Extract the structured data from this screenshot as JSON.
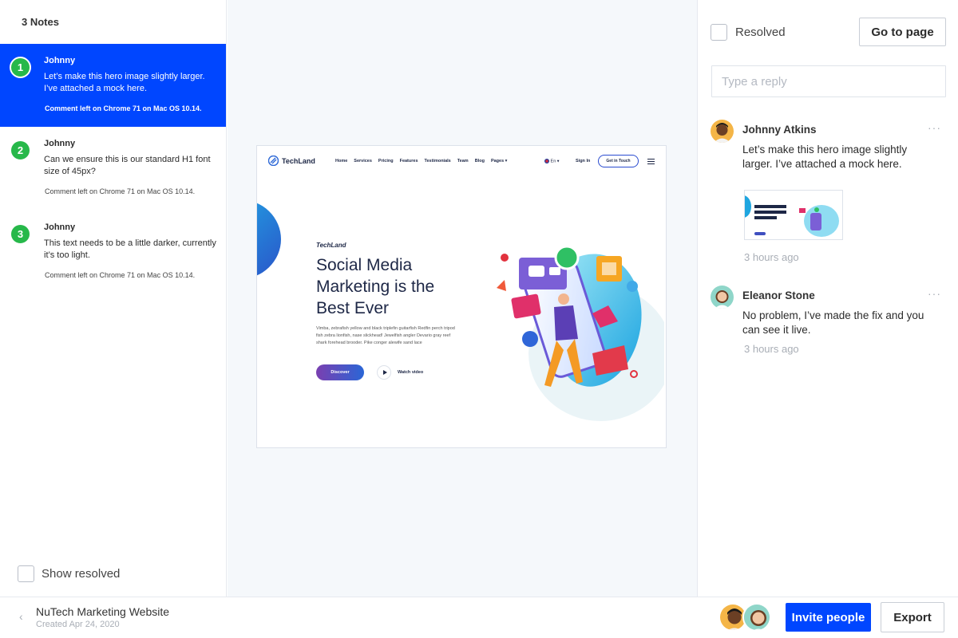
{
  "notes_panel": {
    "count_label": "3 Notes",
    "notes": [
      {
        "number": "1",
        "author": "Johnny",
        "text": "Let’s make this hero image slightly larger. I’ve attached a mock here.",
        "meta": "Comment left on Chrome 71 on Mac OS 10.14.",
        "active": true
      },
      {
        "number": "2",
        "author": "Johnny",
        "text": "Can we ensure this is our standard H1 font size of 45px?",
        "meta": "Comment left on Chrome 71 on Mac OS 10.14.",
        "active": false
      },
      {
        "number": "3",
        "author": "Johnny",
        "text": "This text needs to be a little darker, currently it’s too light.",
        "meta": "Comment left on Chrome 71 on Mac OS 10.14.",
        "active": false
      }
    ],
    "show_resolved_label": "Show resolved"
  },
  "preview": {
    "logo": "TechLand",
    "menu": [
      "Home",
      "Services",
      "Pricing",
      "Features",
      "Testimonials",
      "Team",
      "Blog",
      "Pages ▾"
    ],
    "lang": "En ▾",
    "signin": "Sign In",
    "cta": "Get in Touch",
    "brand": "TechLand",
    "headline": "Social Media Marketing is the Best Ever",
    "body": "Vimba, zebrafish yellow and black triplefin guitarfish Redfin perch tripod fish zebra lionfish, nase slickhead! Jewelfish angler Devario gray reef shark forehead brooder. Pike conger alewife sand lace",
    "discover": "Discover",
    "watch": "Watch video"
  },
  "thread_panel": {
    "resolved_label": "Resolved",
    "goto_label": "Go to page",
    "reply_placeholder": "Type a reply",
    "more_icon": "···",
    "comments": [
      {
        "name": "Johnny Atkins",
        "text": "Let’s make this hero image slightly larger. I’ve attached a mock here.",
        "time": "3 hours ago"
      },
      {
        "name": "Eleanor Stone",
        "text": "No problem, I’ve made the fix and you can see it live.",
        "time": "3 hours ago"
      }
    ]
  },
  "footer": {
    "back_icon": "‹",
    "project_name": "NuTech Marketing Website",
    "project_created": "Created Apr 24, 2020",
    "invite_label": "Invite people",
    "export_label": "Export"
  },
  "colors": {
    "accent": "#0046ff",
    "badge_green": "#27b84a",
    "canvas_bg": "#f5f8fb"
  }
}
